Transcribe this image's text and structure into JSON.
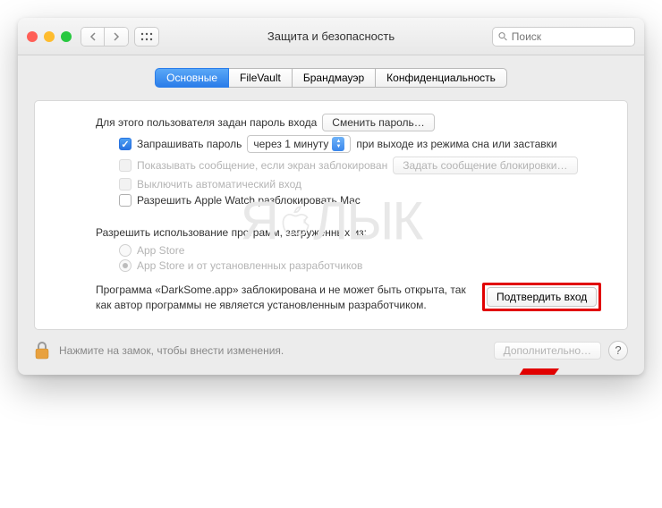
{
  "window": {
    "title": "Защита и безопасность",
    "search_placeholder": "Поиск"
  },
  "tabs": [
    {
      "label": "Основные",
      "active": true
    },
    {
      "label": "FileVault",
      "active": false
    },
    {
      "label": "Брандмауэр",
      "active": false
    },
    {
      "label": "Конфиденциальность",
      "active": false
    }
  ],
  "main": {
    "password_set_label": "Для этого пользователя задан пароль входа",
    "change_password_btn": "Сменить пароль…",
    "require_password_label": "Запрашивать пароль",
    "require_password_delay": "через 1 минуту",
    "require_password_suffix": "при выходе из режима сна или заставки",
    "show_message_label": "Показывать сообщение, если экран заблокирован",
    "set_lock_message_btn": "Задать сообщение блокировки…",
    "disable_auto_login_label": "Выключить автоматический вход",
    "allow_apple_watch_label": "Разрешить Apple Watch разблокировать Mac"
  },
  "download_section": {
    "heading": "Разрешить использование программ, загруженных из:",
    "option_appstore": "App Store",
    "option_identified": "App Store и от установленных разработчиков"
  },
  "blocked": {
    "message": "Программа «DarkSome.app» заблокирована и не может быть открыта, так как автор программы не является установленным разработчиком.",
    "confirm_btn": "Подтвердить вход"
  },
  "footer": {
    "lock_hint": "Нажмите на замок, чтобы внести изменения.",
    "advanced_btn": "Дополнительно…",
    "help": "?"
  },
  "watermark": "ЯБЛЫК"
}
